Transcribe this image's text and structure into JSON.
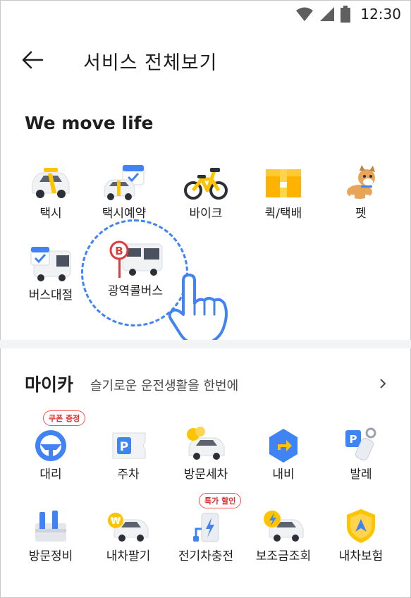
{
  "status": {
    "time": "12:30"
  },
  "header": {
    "title": "서비스 전체보기"
  },
  "section_life": {
    "title": "We move life",
    "items": [
      {
        "label": "택시"
      },
      {
        "label": "택시예약"
      },
      {
        "label": "바이크"
      },
      {
        "label": "퀵/택배"
      },
      {
        "label": "펫"
      },
      {
        "label": "버스대절"
      },
      {
        "label": "광역콜버스"
      }
    ]
  },
  "section_mycar": {
    "title": "마이카",
    "subtitle": "슬기로운 운전생활을 한번에",
    "items": [
      {
        "label": "대리",
        "badge": "쿠폰 증정"
      },
      {
        "label": "주차"
      },
      {
        "label": "방문세차"
      },
      {
        "label": "내비"
      },
      {
        "label": "발레"
      },
      {
        "label": "방문정비"
      },
      {
        "label": "내차팔기"
      },
      {
        "label": "전기차충전",
        "badge": "특가 할인"
      },
      {
        "label": "보조금조회"
      },
      {
        "label": "내차보험"
      }
    ]
  },
  "colors": {
    "accent": "#3f84f2",
    "yellow": "#ffc400",
    "badge_red": "#e02c2c"
  }
}
